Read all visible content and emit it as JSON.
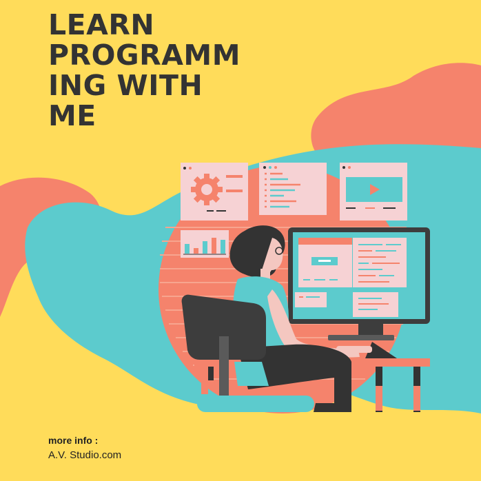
{
  "title_lines": [
    "LEARN",
    "PROGRAMM",
    "ING WITH",
    "ME"
  ],
  "footer": {
    "more_info": "more info :",
    "studio": "A.V. Studio.com"
  },
  "colors": {
    "background": "#ffdc5a",
    "coral": "#f5836c",
    "teal": "#5ccbcd",
    "dark": "#333333",
    "panel": "#f6d2d4"
  },
  "icons": [
    "gear-icon",
    "code-window-icon",
    "video-player-icon",
    "bar-chart-icon",
    "computer-monitor-icon",
    "office-chair-icon",
    "desk-icon"
  ]
}
